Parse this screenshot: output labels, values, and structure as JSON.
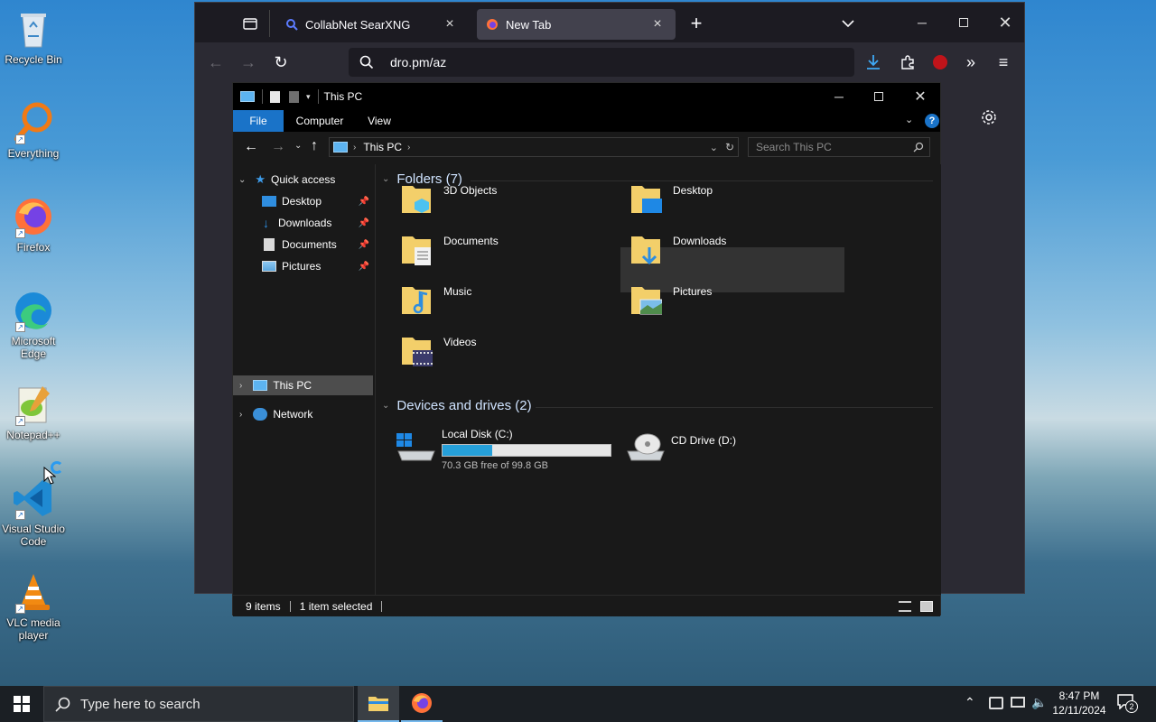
{
  "desktop": {
    "icons": [
      {
        "label": "Recycle Bin"
      },
      {
        "label": "Everything"
      },
      {
        "label": "Firefox"
      },
      {
        "label": "Microsoft Edge"
      },
      {
        "label": "Notepad++"
      },
      {
        "label": "Visual Studio Code"
      },
      {
        "label": "VLC media player"
      }
    ]
  },
  "browser": {
    "tabs": [
      {
        "title": "CollabNet SearXNG"
      },
      {
        "title": "New Tab"
      }
    ],
    "url": "dro.pm/az",
    "new_tab_glyph": "+"
  },
  "explorer": {
    "window_title": "This PC",
    "ribbon_tabs": [
      "File",
      "Computer",
      "View"
    ],
    "breadcrumb": "This PC",
    "search_placeholder": "Search This PC",
    "nav": {
      "quick_access": "Quick access",
      "pinned": [
        "Desktop",
        "Downloads",
        "Documents",
        "Pictures"
      ],
      "this_pc": "This PC",
      "network": "Network"
    },
    "folders_header": "Folders (7)",
    "folders": [
      "3D Objects",
      "Desktop",
      "Documents",
      "Downloads",
      "Music",
      "Pictures",
      "Videos"
    ],
    "drives_header": "Devices and drives (2)",
    "drives": [
      {
        "name": "Local Disk (C:)",
        "free": "70.3 GB free of 99.8 GB",
        "used_fraction": 0.296
      },
      {
        "name": "CD Drive (D:)"
      }
    ],
    "status": {
      "items": "9 items",
      "selected": "1 item selected"
    }
  },
  "taskbar": {
    "search_placeholder": "Type here to search",
    "time": "8:47 PM",
    "date": "12/11/2024",
    "notifications": "2"
  },
  "colors": {
    "accent": "#0078d7",
    "drive_bar": "#26a0da"
  }
}
